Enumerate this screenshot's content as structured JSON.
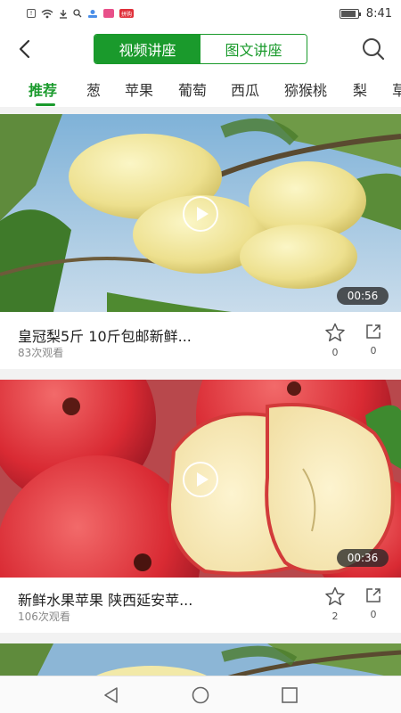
{
  "status_bar": {
    "time": "8:41",
    "left_icons": [
      "sim-icon",
      "wifi-icon",
      "download-icon",
      "search-icon",
      "app-icon",
      "app-icon",
      "app-icon"
    ],
    "red_badge": "拼购"
  },
  "header": {
    "tabs": [
      {
        "label": "视频讲座",
        "active": true
      },
      {
        "label": "图文讲座",
        "active": false
      }
    ]
  },
  "categories": [
    "推荐",
    "葱",
    "苹果",
    "葡萄",
    "西瓜",
    "猕猴桃",
    "梨",
    "草"
  ],
  "videos": [
    {
      "title": "皇冠梨5斤 10斤包邮新鲜...",
      "views": "83次观看",
      "duration": "00:56",
      "favorites": "0",
      "shares": "0"
    },
    {
      "title": "新鲜水果苹果 陕西延安苹...",
      "views": "106次观看",
      "duration": "00:36",
      "favorites": "2",
      "shares": "0"
    }
  ],
  "colors": {
    "accent": "#1a9a2c"
  }
}
